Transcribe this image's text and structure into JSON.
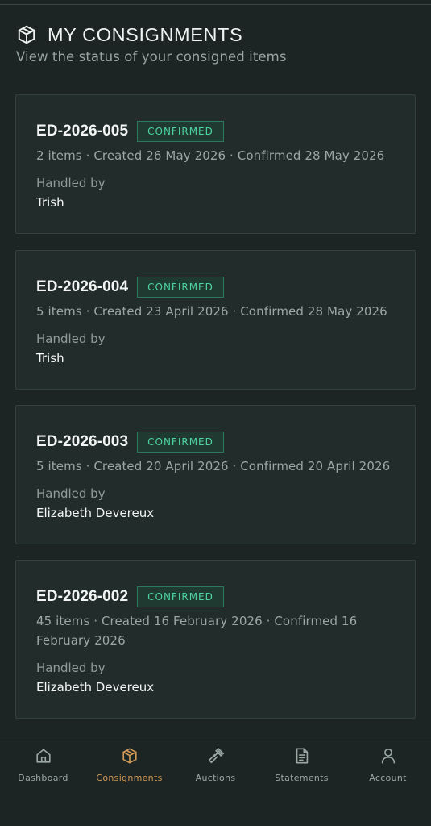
{
  "header": {
    "title": "MY CONSIGNMENTS",
    "subtitle": "View the status of your consigned items",
    "icon": "package-icon"
  },
  "consignments": [
    {
      "ref": "ED-2026-005",
      "status": "CONFIRMED",
      "meta": "2 items · Created 26 May 2026 · Confirmed 28 May 2026",
      "handled_label": "Handled by",
      "handler": "Trish"
    },
    {
      "ref": "ED-2026-004",
      "status": "CONFIRMED",
      "meta": "5 items · Created 23 April 2026 · Confirmed 28 May 2026",
      "handled_label": "Handled by",
      "handler": "Trish"
    },
    {
      "ref": "ED-2026-003",
      "status": "CONFIRMED",
      "meta": "5 items · Created 20 April 2026 · Confirmed 20 April 2026",
      "handled_label": "Handled by",
      "handler": "Elizabeth Devereux"
    },
    {
      "ref": "ED-2026-002",
      "status": "CONFIRMED",
      "meta_line1": "45 items · Created 16 February 2026 · Confirmed 16",
      "meta_line2": "February 2026",
      "handled_label": "Handled by",
      "handler": "Elizabeth Devereux"
    }
  ],
  "nav": {
    "items": [
      {
        "label": "Dashboard",
        "icon": "home-icon",
        "active": false
      },
      {
        "label": "Consignments",
        "icon": "package-icon",
        "active": true
      },
      {
        "label": "Auctions",
        "icon": "gavel-icon",
        "active": false
      },
      {
        "label": "Statements",
        "icon": "document-icon",
        "active": false
      },
      {
        "label": "Account",
        "icon": "user-icon",
        "active": false
      }
    ]
  },
  "colors": {
    "background": "#1c2523",
    "card": "#222d2b",
    "badge_text": "#4fd3a0",
    "badge_border": "#2f7a5e",
    "active_nav": "#d19a58"
  }
}
